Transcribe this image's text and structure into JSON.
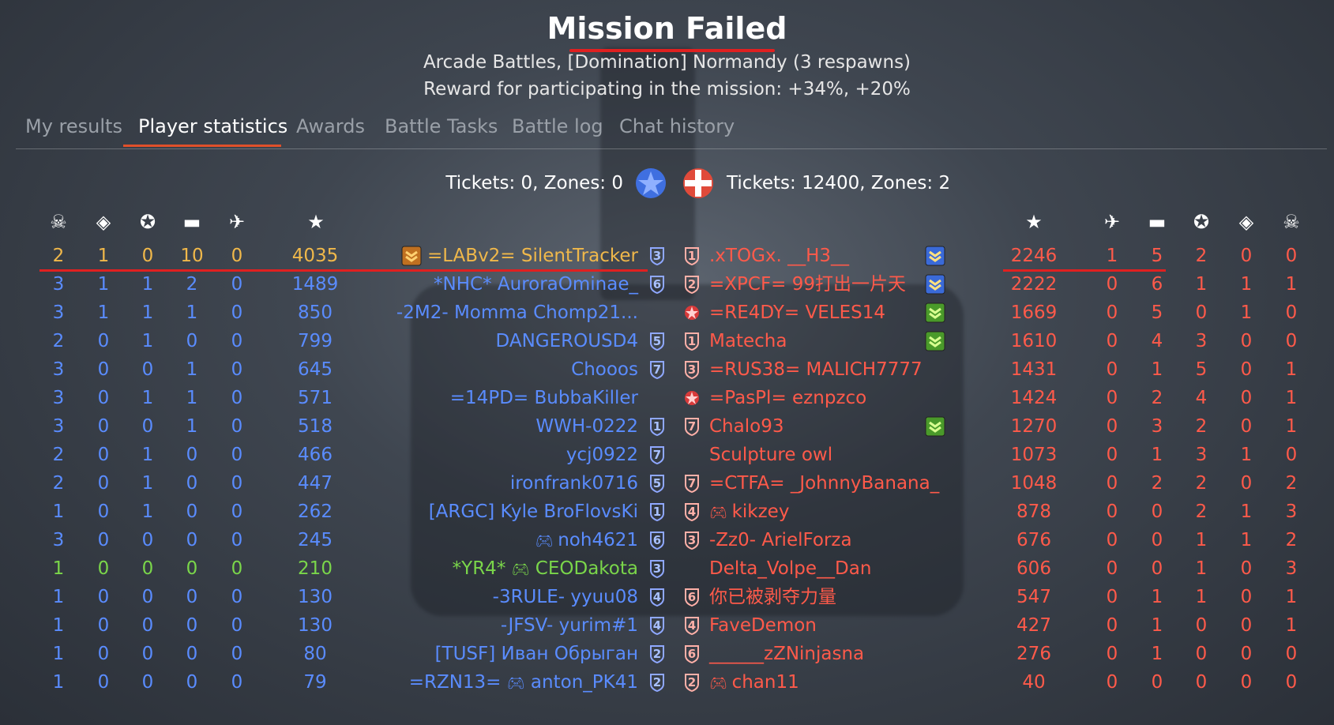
{
  "header": {
    "title": "Mission Failed",
    "subtitle": "Arcade Battles, [Domination] Normandy (3 respawns)",
    "reward": "Reward for participating in the mission: +34%, +20%"
  },
  "tabs": [
    "My results",
    "Player statistics",
    "Awards",
    "Battle Tasks",
    "Battle log",
    "Chat history"
  ],
  "active_tab": "Player statistics",
  "tickets": {
    "left": "Tickets: 0, Zones: 0",
    "right": "Tickets: 12400, Zones: 2"
  },
  "colors": {
    "allies": "#5a8cff",
    "enemies": "#ff5a4a",
    "self": "#f0b84a",
    "squad": "#7ad64a",
    "accent": "#e02020"
  },
  "column_icons": [
    "skull-icon",
    "capture-icon",
    "air-kill-icon",
    "tank-icon",
    "plane-icon",
    "star-icon"
  ],
  "left_team": [
    {
      "deaths": "2",
      "captures": "1",
      "air": "0",
      "ground": "10",
      "planes": "0",
      "score": "4035",
      "name": "=LABv2= SilentTracker",
      "rank": "3",
      "badge": "gold",
      "color": "gold"
    },
    {
      "deaths": "3",
      "captures": "1",
      "air": "1",
      "ground": "2",
      "planes": "0",
      "score": "1489",
      "name": "*NHC* AuroraOminae_",
      "rank": "6",
      "badge": "",
      "color": "blue"
    },
    {
      "deaths": "3",
      "captures": "1",
      "air": "1",
      "ground": "1",
      "planes": "0",
      "score": "850",
      "name": "-2M2- Momma Chomp21...",
      "rank": "",
      "badge": "",
      "color": "blue"
    },
    {
      "deaths": "2",
      "captures": "0",
      "air": "1",
      "ground": "0",
      "planes": "0",
      "score": "799",
      "name": "DANGEROUSD4",
      "rank": "5",
      "badge": "",
      "color": "blue"
    },
    {
      "deaths": "3",
      "captures": "0",
      "air": "0",
      "ground": "1",
      "planes": "0",
      "score": "645",
      "name": "Chooos",
      "rank": "7",
      "badge": "",
      "color": "blue"
    },
    {
      "deaths": "3",
      "captures": "0",
      "air": "1",
      "ground": "1",
      "planes": "0",
      "score": "571",
      "name": "=14PD= BubbaKiller",
      "rank": "",
      "badge": "",
      "color": "blue"
    },
    {
      "deaths": "3",
      "captures": "0",
      "air": "0",
      "ground": "1",
      "planes": "0",
      "score": "518",
      "name": "WWH-0222",
      "rank": "1",
      "badge": "",
      "color": "blue"
    },
    {
      "deaths": "2",
      "captures": "0",
      "air": "1",
      "ground": "0",
      "planes": "0",
      "score": "466",
      "name": "ycj0922",
      "rank": "7",
      "badge": "",
      "color": "blue"
    },
    {
      "deaths": "2",
      "captures": "0",
      "air": "1",
      "ground": "0",
      "planes": "0",
      "score": "447",
      "name": "ironfrank0716",
      "rank": "5",
      "badge": "",
      "color": "blue"
    },
    {
      "deaths": "1",
      "captures": "0",
      "air": "1",
      "ground": "0",
      "planes": "0",
      "score": "262",
      "name": "[ARGC] Kyle BroFlovsKi",
      "rank": "1",
      "badge": "",
      "color": "blue"
    },
    {
      "deaths": "3",
      "captures": "0",
      "air": "0",
      "ground": "0",
      "planes": "0",
      "score": "245",
      "name": "noh4621",
      "rank": "6",
      "badge": "",
      "color": "blue",
      "gamepad": true
    },
    {
      "deaths": "1",
      "captures": "0",
      "air": "0",
      "ground": "0",
      "planes": "0",
      "score": "210",
      "name": "*YR4* CEODakota",
      "rank": "3",
      "badge": "",
      "color": "green",
      "gamepad": true
    },
    {
      "deaths": "1",
      "captures": "0",
      "air": "0",
      "ground": "0",
      "planes": "0",
      "score": "130",
      "name": "-3RULE- yyuu08",
      "rank": "4",
      "badge": "",
      "color": "blue"
    },
    {
      "deaths": "1",
      "captures": "0",
      "air": "0",
      "ground": "0",
      "planes": "0",
      "score": "130",
      "name": "-JFSV- yurim#1",
      "rank": "4",
      "badge": "",
      "color": "blue"
    },
    {
      "deaths": "1",
      "captures": "0",
      "air": "0",
      "ground": "0",
      "planes": "0",
      "score": "80",
      "name": "[TUSF] Иван Обрыган",
      "rank": "2",
      "badge": "",
      "color": "blue"
    },
    {
      "deaths": "1",
      "captures": "0",
      "air": "0",
      "ground": "0",
      "planes": "0",
      "score": "79",
      "name": "=RZN13= anton_PK41",
      "rank": "2",
      "badge": "",
      "color": "blue",
      "gamepad": true
    }
  ],
  "right_team": [
    {
      "rank": "1",
      "name": ".xTOGx. __H3__",
      "badge": "blue",
      "score": "2246",
      "planes": "1",
      "ground": "5",
      "air": "2",
      "captures": "0",
      "deaths": "0"
    },
    {
      "rank": "2",
      "name": "=XPCF= 99打出一片天",
      "badge": "blue",
      "score": "2222",
      "planes": "0",
      "ground": "6",
      "air": "1",
      "captures": "1",
      "deaths": "1"
    },
    {
      "rank": "star",
      "name": "=RE4DY= VELES14",
      "badge": "green",
      "score": "1669",
      "planes": "0",
      "ground": "5",
      "air": "0",
      "captures": "1",
      "deaths": "0"
    },
    {
      "rank": "1",
      "name": "Matecha",
      "badge": "green",
      "score": "1610",
      "planes": "0",
      "ground": "4",
      "air": "3",
      "captures": "0",
      "deaths": "0"
    },
    {
      "rank": "3",
      "name": "=RUS38= MALICH7777",
      "badge": "",
      "score": "1431",
      "planes": "0",
      "ground": "1",
      "air": "5",
      "captures": "0",
      "deaths": "1"
    },
    {
      "rank": "star",
      "name": "=PasPl= eznpzco",
      "badge": "",
      "score": "1424",
      "planes": "0",
      "ground": "2",
      "air": "4",
      "captures": "0",
      "deaths": "1"
    },
    {
      "rank": "7",
      "name": "Chalo93",
      "badge": "green",
      "score": "1270",
      "planes": "0",
      "ground": "3",
      "air": "2",
      "captures": "0",
      "deaths": "1"
    },
    {
      "rank": "",
      "name": "Sculpture owl",
      "badge": "",
      "score": "1073",
      "planes": "0",
      "ground": "1",
      "air": "3",
      "captures": "1",
      "deaths": "0"
    },
    {
      "rank": "7",
      "name": "=CTFA= _JohnnyBanana_",
      "badge": "",
      "score": "1048",
      "planes": "0",
      "ground": "2",
      "air": "2",
      "captures": "0",
      "deaths": "2"
    },
    {
      "rank": "4",
      "name": "kikzey",
      "badge": "",
      "score": "878",
      "planes": "0",
      "ground": "0",
      "air": "2",
      "captures": "1",
      "deaths": "3",
      "gamepad": true
    },
    {
      "rank": "3",
      "name": "-Zz0- ArielForza",
      "badge": "",
      "score": "676",
      "planes": "0",
      "ground": "0",
      "air": "1",
      "captures": "1",
      "deaths": "2"
    },
    {
      "rank": "",
      "name": "Delta_Volpe__Dan",
      "badge": "",
      "score": "606",
      "planes": "0",
      "ground": "0",
      "air": "1",
      "captures": "0",
      "deaths": "3"
    },
    {
      "rank": "6",
      "name": "你已被剥夺力量",
      "badge": "",
      "score": "547",
      "planes": "0",
      "ground": "1",
      "air": "1",
      "captures": "0",
      "deaths": "1"
    },
    {
      "rank": "4",
      "name": "FaveDemon",
      "badge": "",
      "score": "427",
      "planes": "0",
      "ground": "1",
      "air": "0",
      "captures": "0",
      "deaths": "1"
    },
    {
      "rank": "6",
      "name": "______zZNinjasna",
      "badge": "",
      "score": "276",
      "planes": "0",
      "ground": "1",
      "air": "0",
      "captures": "0",
      "deaths": "0"
    },
    {
      "rank": "2",
      "name": "chan11",
      "badge": "",
      "score": "40",
      "planes": "0",
      "ground": "0",
      "air": "0",
      "captures": "0",
      "deaths": "0",
      "gamepad": true
    }
  ]
}
